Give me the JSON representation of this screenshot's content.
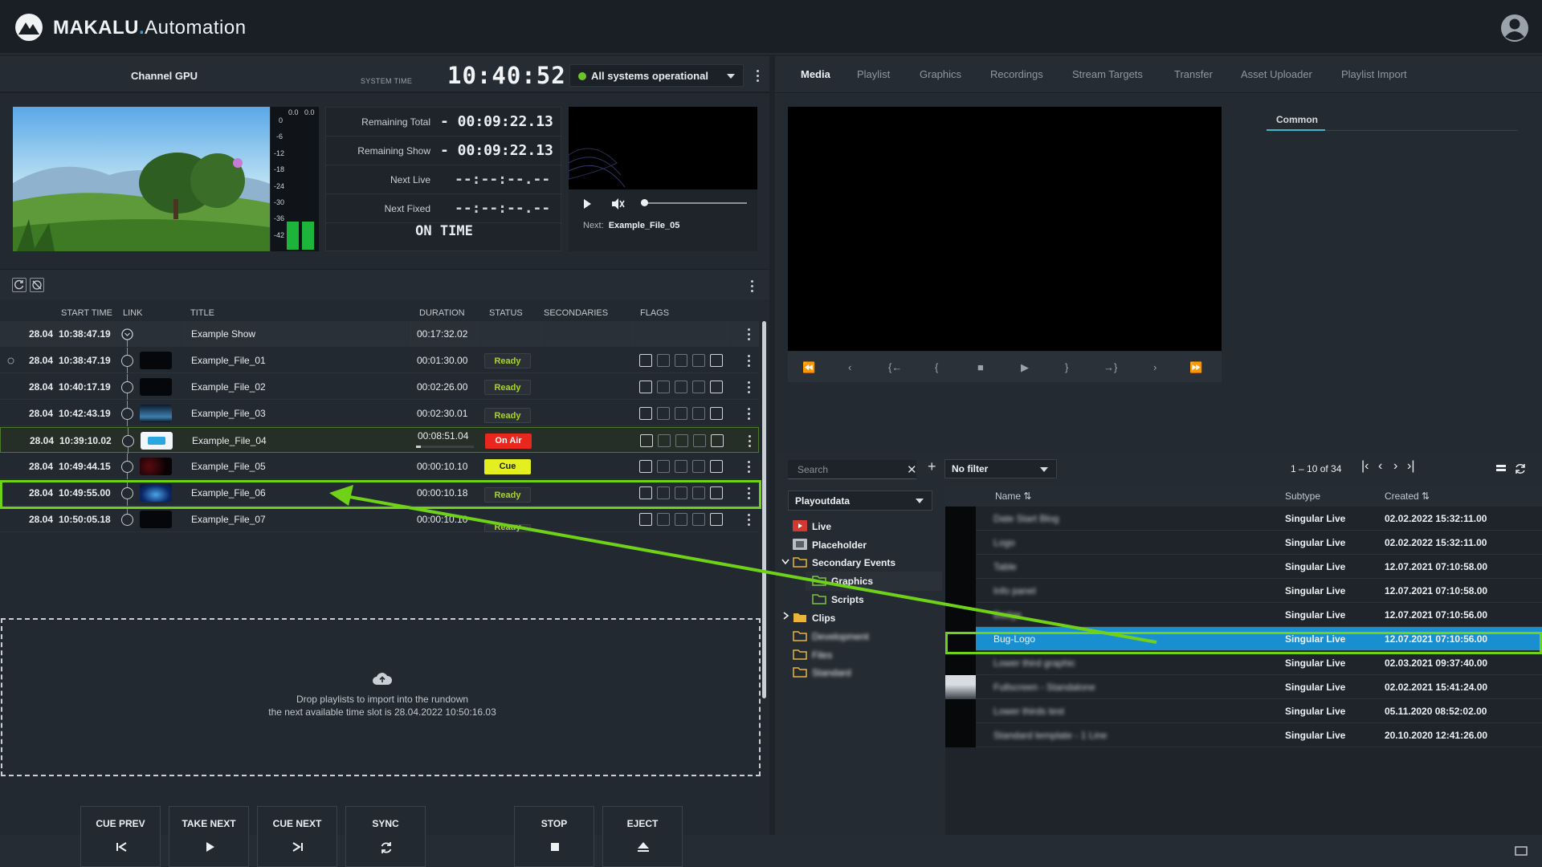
{
  "app": {
    "brand_main": "MAKALU",
    "brand_dot": ".",
    "brand_sub": "Automation"
  },
  "channel": {
    "name": "Channel GPU",
    "system_time_label": "SYSTEM TIME",
    "clock": "10:40:52",
    "status": "All systems operational",
    "status_color": "#6cc62a"
  },
  "meter": {
    "top_left": "0.0",
    "top_right": "0.0",
    "scale": [
      "0",
      "-6",
      "-12",
      "-18",
      "-24",
      "-30",
      "-36",
      "-42"
    ],
    "level_left": 0.2,
    "level_right": 0.2
  },
  "timers": [
    {
      "label": "Remaining Total",
      "value": "- 00:09:22.13"
    },
    {
      "label": "Remaining Show",
      "value": "- 00:09:22.13"
    },
    {
      "label": "Next Live",
      "value": "--:--:--.--"
    },
    {
      "label": "Next Fixed",
      "value": "--:--:--.--"
    }
  ],
  "on_time": "ON TIME",
  "mini_player": {
    "next_label": "Next:",
    "next_value": "Example_File_05",
    "progress": 0
  },
  "table": {
    "headers": {
      "start": "START TIME",
      "link": "LINK",
      "title": "TITLE",
      "duration": "DURATION",
      "status": "STATUS",
      "secondaries": "SECONDARIES",
      "flags": "FLAGS"
    },
    "show": {
      "date": "28.04",
      "time": "10:38:47.19",
      "title": "Example Show",
      "duration": "00:17:32.02"
    },
    "rows": [
      {
        "date": "28.04",
        "time": "10:38:47.19",
        "title": "Example_File_01",
        "duration": "00:01:30.00",
        "status": "Ready"
      },
      {
        "date": "28.04",
        "time": "10:40:17.19",
        "title": "Example_File_02",
        "duration": "00:02:26.00",
        "status": "Ready"
      },
      {
        "date": "28.04",
        "time": "10:42:43.19",
        "title": "Example_File_03",
        "duration": "00:02:30.01",
        "status": "Ready"
      },
      {
        "date": "28.04",
        "time": "10:39:10.02",
        "title": "Example_File_04",
        "duration": "00:08:51.04",
        "status": "On Air"
      },
      {
        "date": "28.04",
        "time": "10:49:44.15",
        "title": "Example_File_05",
        "duration": "00:00:10.10",
        "status": "Cue"
      },
      {
        "date": "28.04",
        "time": "10:49:55.00",
        "title": "Example_File_06",
        "duration": "00:00:10.18",
        "status": "Ready"
      },
      {
        "date": "28.04",
        "time": "10:50:05.18",
        "title": "Example_File_07",
        "duration": "00:00:10.10",
        "status": "Ready"
      }
    ],
    "on_air_progress": 0.08
  },
  "drop_zone": {
    "line1": "Drop playlists to import into the rundown",
    "line2": "the next available time slot is 28.04.2022 10:50:16.03"
  },
  "controls": [
    {
      "label": "CUE PREV",
      "icon": "skip-previous-icon"
    },
    {
      "label": "TAKE NEXT",
      "icon": "play-icon"
    },
    {
      "label": "CUE NEXT",
      "icon": "skip-next-icon"
    },
    {
      "label": "SYNC",
      "icon": "sync-icon"
    },
    {
      "label": "STOP",
      "icon": "stop-icon"
    },
    {
      "label": "EJECT",
      "icon": "eject-icon"
    }
  ],
  "tabs": [
    "Media",
    "Playlist",
    "Graphics",
    "Recordings",
    "Stream Targets",
    "Transfer",
    "Asset Uploader",
    "Playlist Import"
  ],
  "transport": [
    "⏪",
    "‹",
    "{←",
    "{",
    "■",
    "▶",
    "}",
    "→}",
    "›",
    "⏩"
  ],
  "properties_tab": "Common",
  "media": {
    "search_placeholder": "Search",
    "filter": "No filter",
    "pager": "1 – 10 of 34",
    "folder": "Playoutdata",
    "tree": [
      {
        "label": "Live",
        "icon": "live-icon"
      },
      {
        "label": "Placeholder",
        "icon": "placeholder-icon"
      },
      {
        "label": "Secondary Events",
        "icon": "folder-icon"
      },
      {
        "label": "Graphics",
        "icon": "folder-icon"
      },
      {
        "label": "Scripts",
        "icon": "folder-icon"
      },
      {
        "label": "Clips",
        "icon": "folder-icon"
      },
      {
        "label": "Development",
        "icon": "folder-icon"
      },
      {
        "label": "Files",
        "icon": "folder-icon"
      },
      {
        "label": "Standard",
        "icon": "folder-icon"
      }
    ],
    "columns": {
      "name": "Name ⇅",
      "subtype": "Subtype",
      "created": "Created ⇅"
    },
    "files": [
      {
        "name": "Date Start Blog",
        "subtype": "Singular Live",
        "created": "02.02.2022 15:32:11.00"
      },
      {
        "name": "Logo",
        "subtype": "Singular Live",
        "created": "02.02.2022 15:32:11.00"
      },
      {
        "name": "Table",
        "subtype": "Singular Live",
        "created": "12.07.2021 07:10:58.00"
      },
      {
        "name": "Info panel",
        "subtype": "Singular Live",
        "created": "12.07.2021 07:10:58.00"
      },
      {
        "name": "Badge",
        "subtype": "Singular Live",
        "created": "12.07.2021 07:10:56.00"
      },
      {
        "name": "Bug-Logo",
        "subtype": "Singular Live",
        "created": "12.07.2021 07:10:56.00"
      },
      {
        "name": "Lower third graphic",
        "subtype": "Singular Live",
        "created": "02.03.2021 09:37:40.00"
      },
      {
        "name": "Fullscreen - Standalone",
        "subtype": "Singular Live",
        "created": "02.02.2021 15:41:24.00"
      },
      {
        "name": "Lower thirds test",
        "subtype": "Singular Live",
        "created": "05.11.2020 08:52:02.00"
      },
      {
        "name": "Standard template - 1 Line",
        "subtype": "Singular Live",
        "created": "20.10.2020 12:41:26.00"
      }
    ]
  },
  "colors": {
    "accent": "#2aa7e0",
    "highlight": "#6fd219",
    "on_air": "#e8281f",
    "cue": "#e4ef21",
    "ready_text": "#a9d430",
    "selected_row": "#1a8fd0"
  }
}
